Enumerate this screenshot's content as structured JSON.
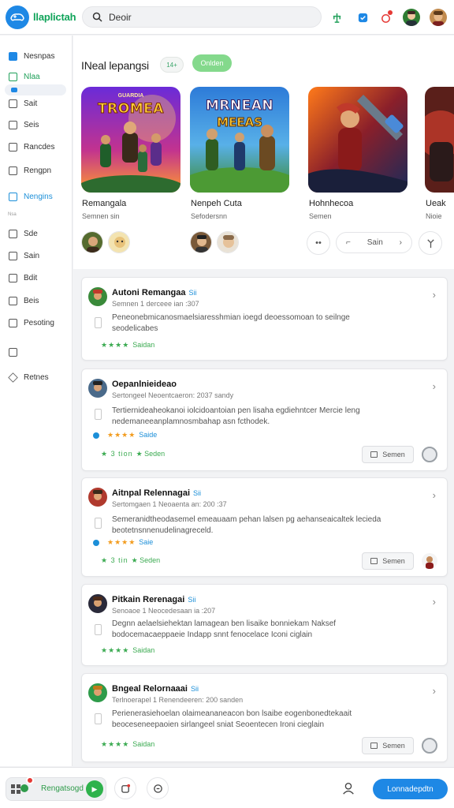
{
  "app": {
    "name": "llaplictah"
  },
  "search": {
    "value": "Deoir",
    "placeholder": "Deoir"
  },
  "colors": {
    "accent": "#1e88e5",
    "brand_green": "#10a45a",
    "star_green": "#3cab52",
    "star_orange": "#f29c1f"
  },
  "topbar_icons": [
    "tree-icon",
    "shield-icon",
    "notification-icon",
    "avatar",
    "profile-avatar"
  ],
  "sidebar": {
    "items": [
      {
        "label": "Nesnpas",
        "icon": "home-icon"
      },
      {
        "label": "Nlaa",
        "icon": "games-icon"
      },
      {
        "label": "Sait",
        "icon": "store-icon"
      },
      {
        "label": "Seis",
        "icon": "library-icon"
      },
      {
        "label": "Rancdes",
        "icon": "rankings-icon"
      },
      {
        "label": "Rengpn",
        "icon": "news-icon"
      },
      {
        "label": "Nengins",
        "icon": "engines-icon"
      },
      {
        "label": "Sde",
        "icon": "side-icon"
      },
      {
        "label": "Sain",
        "icon": "saved-icon"
      },
      {
        "label": "Bdit",
        "icon": "edit-icon"
      },
      {
        "label": "Beis",
        "icon": "bells-icon"
      },
      {
        "label": "Pesoting",
        "icon": "posting-icon"
      },
      {
        "label": "",
        "icon": "image-icon"
      },
      {
        "label": "Retnes",
        "icon": "retries-icon"
      }
    ],
    "tiny_label": "Nsa"
  },
  "featured": {
    "title": "INeal lepangsi",
    "chip_small": "14+",
    "chip_green": "Onlden",
    "games": [
      {
        "name": "Remangala",
        "sub": "Semnen sin",
        "art_line1": "TROMEA",
        "art_line2": "",
        "art_small": "GUARDIA"
      },
      {
        "name": "Nenpeh Cuta",
        "sub": "Sefodersnn",
        "art_line1": "MRNEAN",
        "art_line2": "MEEAS",
        "art_small": ""
      },
      {
        "name": "Hohnhecoa",
        "sub": "Semen",
        "art_line1": "",
        "art_line2": "",
        "art_small": ""
      },
      {
        "name": "Ueak",
        "sub": "Nioie",
        "art_line1": "",
        "art_line2": "",
        "art_small": ""
      }
    ],
    "pill_button": {
      "label": "Sain",
      "icon_left": "⌐",
      "icon_right": "›"
    },
    "more_button": "••"
  },
  "reviews": [
    {
      "title": "Autoni Remangaa",
      "tag": "Sii",
      "meta": "Semnen 1 derceee ian :307",
      "body": "Peneonebmicanosmaelsiaresshmian ioegd deoessomoan to seilnge seodelicabes",
      "stars": "★★★★",
      "star_label": "Saidan",
      "orange_stars": "",
      "orange_label": "",
      "stars2": "",
      "stars2_label": "",
      "button": "",
      "right": "none"
    },
    {
      "title": "Oepanlnieideao",
      "tag": "",
      "meta": "Sertongeel Neoentcaeron: 2037 sandy",
      "body": "Tertiernideaheokanoi iolcidoantoian pen lisaha egdiehntcer Mercie leng nedemaneeanplamnosmbahap asn fcthodek.",
      "stars": "★ 3 tion",
      "star_label": "★ Seden",
      "orange_stars": "★★★★",
      "orange_label": "Saide",
      "button": "Semen",
      "right": "gray-circle"
    },
    {
      "title": "Aitnpal Relennagai",
      "tag": "Sii",
      "meta": "Sertomgaen 1 Neoaenta an: 200 :37",
      "body": "Semeranidtheodasemel emeauaam pehan lalsen pg aehanseaicaltek lecieda beotetnsnnenudelinagreceld.",
      "stars": "★ 3 tin",
      "star_label": "★ Seden",
      "orange_stars": "★★★★",
      "orange_label": "Saie",
      "button": "Semen",
      "right": "avatar"
    },
    {
      "title": "Pitkain Rerenagai",
      "tag": "Sii",
      "meta": "Senoaoe 1 Neocedesaan ia :207",
      "body": "Degnn aelaelsiehektan lamagean ben lisaike bonniekam Naksef bodocemacaeppaeie Indapp snnt fenocelace Iconi ciglain",
      "stars": "★★★★",
      "star_label": "Saidan",
      "orange_stars": "",
      "orange_label": "",
      "button": "",
      "right": "none"
    },
    {
      "title": "Bngeal Relornaaai",
      "tag": "Sii",
      "meta": "Terlnoerapel 1 Renendeeren: 200 sanden",
      "body": "Perienerasiehoelan olaimeananeacon bon lsaibe eogenbonedtekaait beoceseneepaoien sirlangeel sniat Seoentecen Ironi cieglain",
      "stars": "★★★★",
      "star_label": "Saidan",
      "orange_stars": "",
      "orange_label": "",
      "button": "Semen",
      "right": "gray-circle"
    }
  ],
  "bottombar": {
    "left_label": "Rengatsogd",
    "primary_button": "Lonnadepdtn"
  }
}
